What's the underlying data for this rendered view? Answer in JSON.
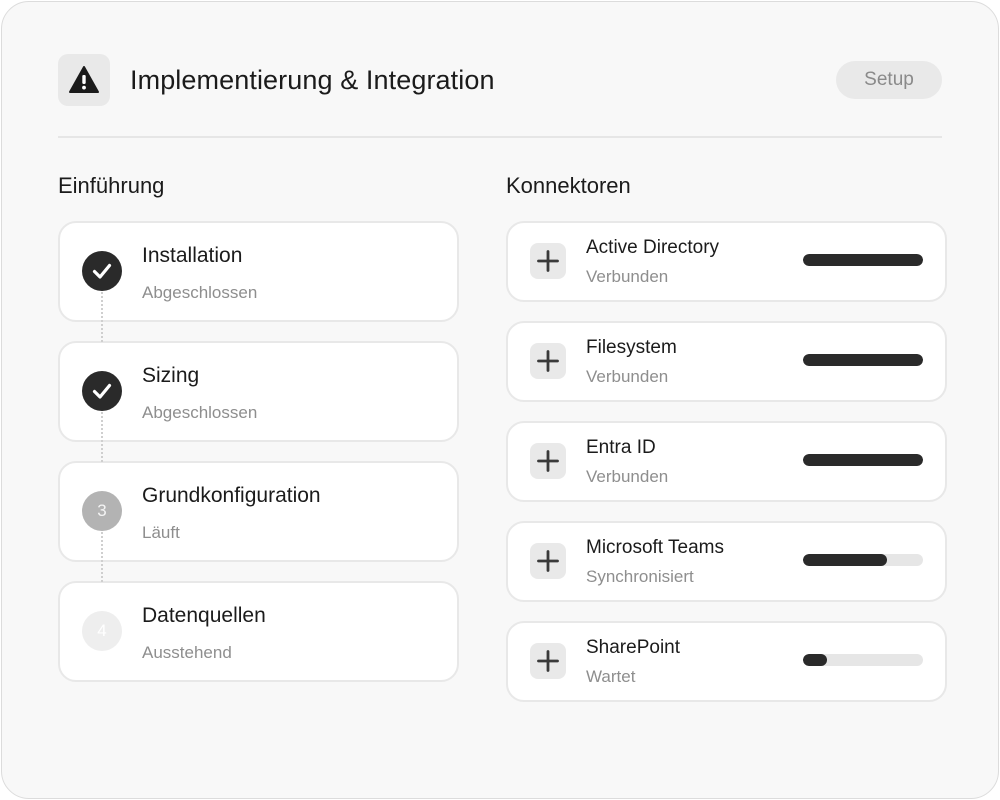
{
  "header": {
    "title": "Implementierung & Integration",
    "icon": "warning-icon",
    "setup_label": "Setup"
  },
  "onboarding": {
    "title": "Einführung",
    "steps": [
      {
        "number": "1",
        "title": "Installation",
        "status": "Abgeschlossen",
        "state": "done"
      },
      {
        "number": "2",
        "title": "Sizing",
        "status": "Abgeschlossen",
        "state": "done"
      },
      {
        "number": "3",
        "title": "Grundkonfiguration",
        "status": "Läuft",
        "state": "active"
      },
      {
        "number": "4",
        "title": "Datenquellen",
        "status": "Ausstehend",
        "state": "pending"
      }
    ]
  },
  "connectors": {
    "title": "Konnektoren",
    "items": [
      {
        "name": "Active Directory",
        "status": "Verbunden",
        "progress": 1.0,
        "icon": "plus-icon"
      },
      {
        "name": "Filesystem",
        "status": "Verbunden",
        "progress": 1.0,
        "icon": "plus-icon"
      },
      {
        "name": "Entra ID",
        "status": "Verbunden",
        "progress": 1.0,
        "icon": "plus-icon"
      },
      {
        "name": "Microsoft Teams",
        "status": "Synchronisiert",
        "progress": 0.7,
        "icon": "plus-icon"
      },
      {
        "name": "SharePoint",
        "status": "Wartet",
        "progress": 0.2,
        "icon": "plus-icon"
      }
    ]
  },
  "colors": {
    "accent": "#2a2a2a",
    "background": "#f8f8f8",
    "card": "#ffffff",
    "muted_text": "#8e8e8e"
  }
}
